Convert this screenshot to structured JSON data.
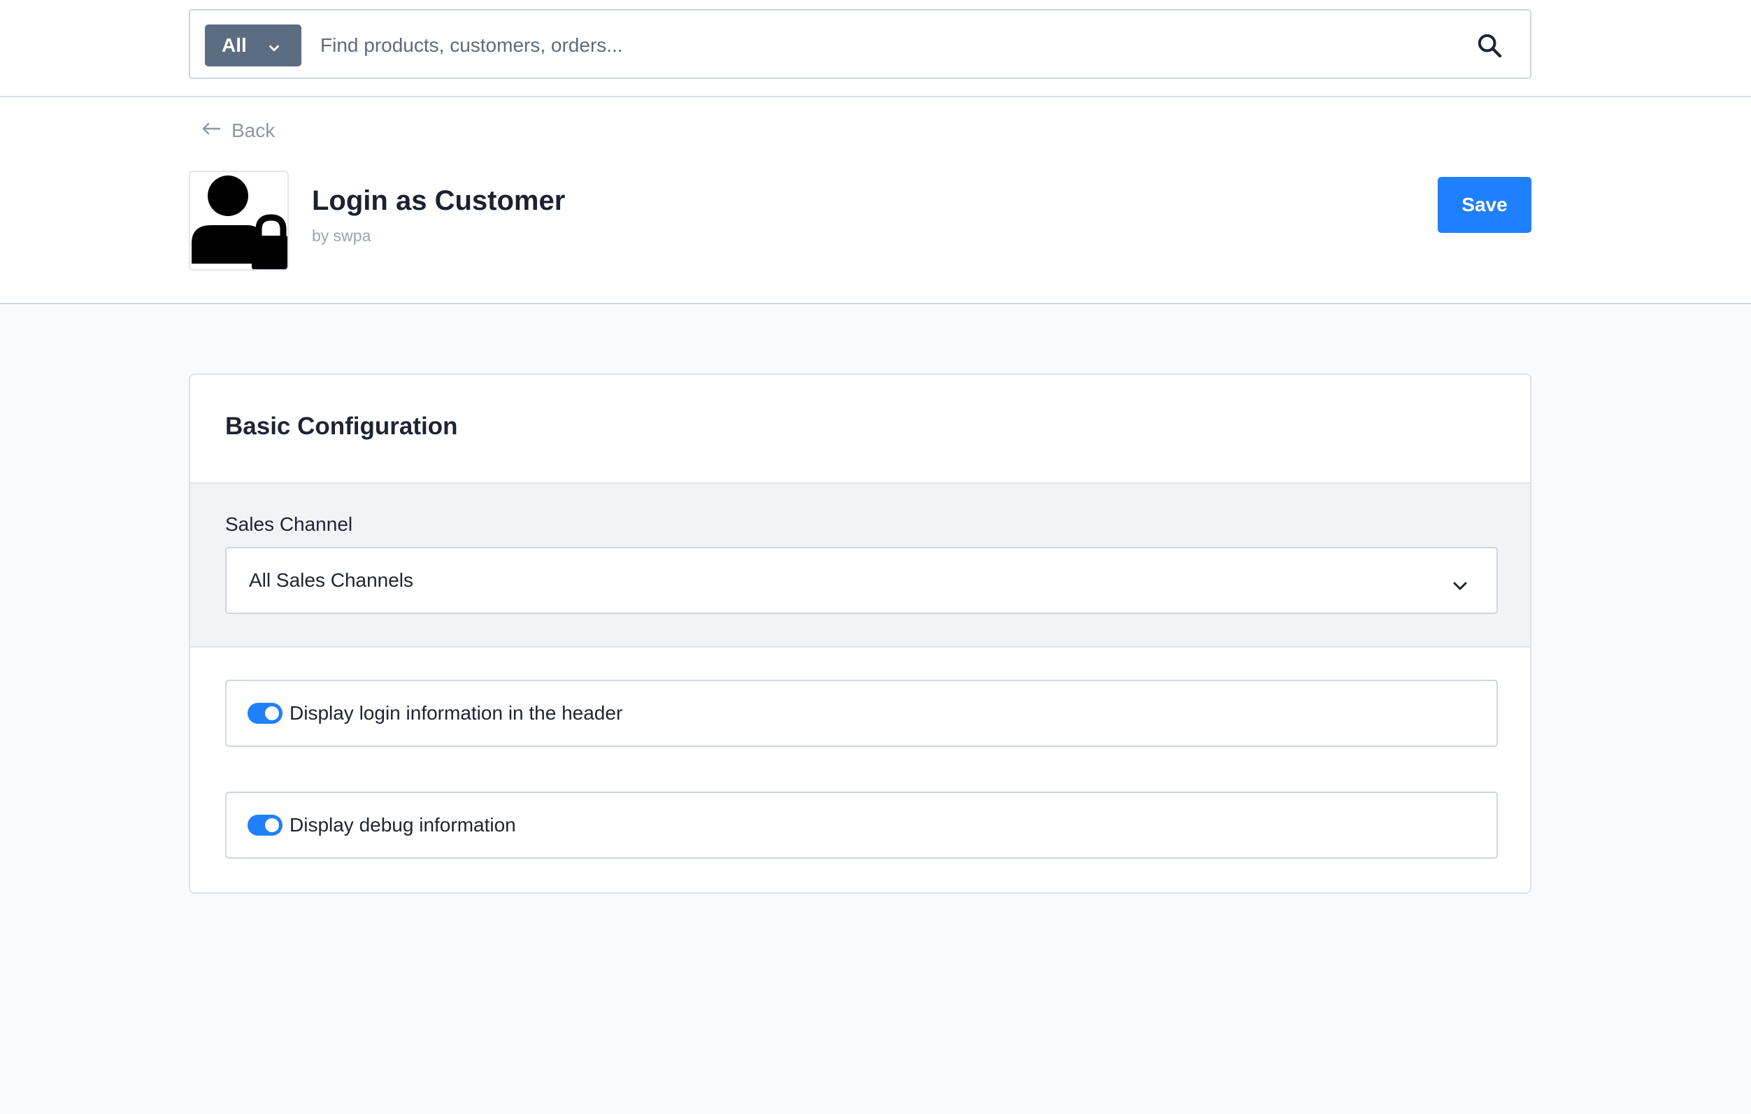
{
  "search": {
    "type_label": "All",
    "placeholder": "Find products, customers, orders..."
  },
  "header": {
    "back_label": "Back",
    "title": "Login as Customer",
    "author": "by swpa",
    "save_label": "Save"
  },
  "config": {
    "title": "Basic Configuration",
    "sales_channel_label": "Sales Channel",
    "sales_channel_value": "All Sales Channels",
    "toggles": [
      {
        "label": "Display login information in the header",
        "enabled": true
      },
      {
        "label": "Display debug information",
        "enabled": true
      }
    ]
  },
  "colors": {
    "accent": "#1f80ff",
    "search_type_bg": "#5b6e81",
    "page_bg": "#f9fafc"
  },
  "icons": {
    "search": "search-icon",
    "back": "arrow-left-icon",
    "app": "user-lock-icon",
    "dropdown": "chevron-down-icon"
  }
}
